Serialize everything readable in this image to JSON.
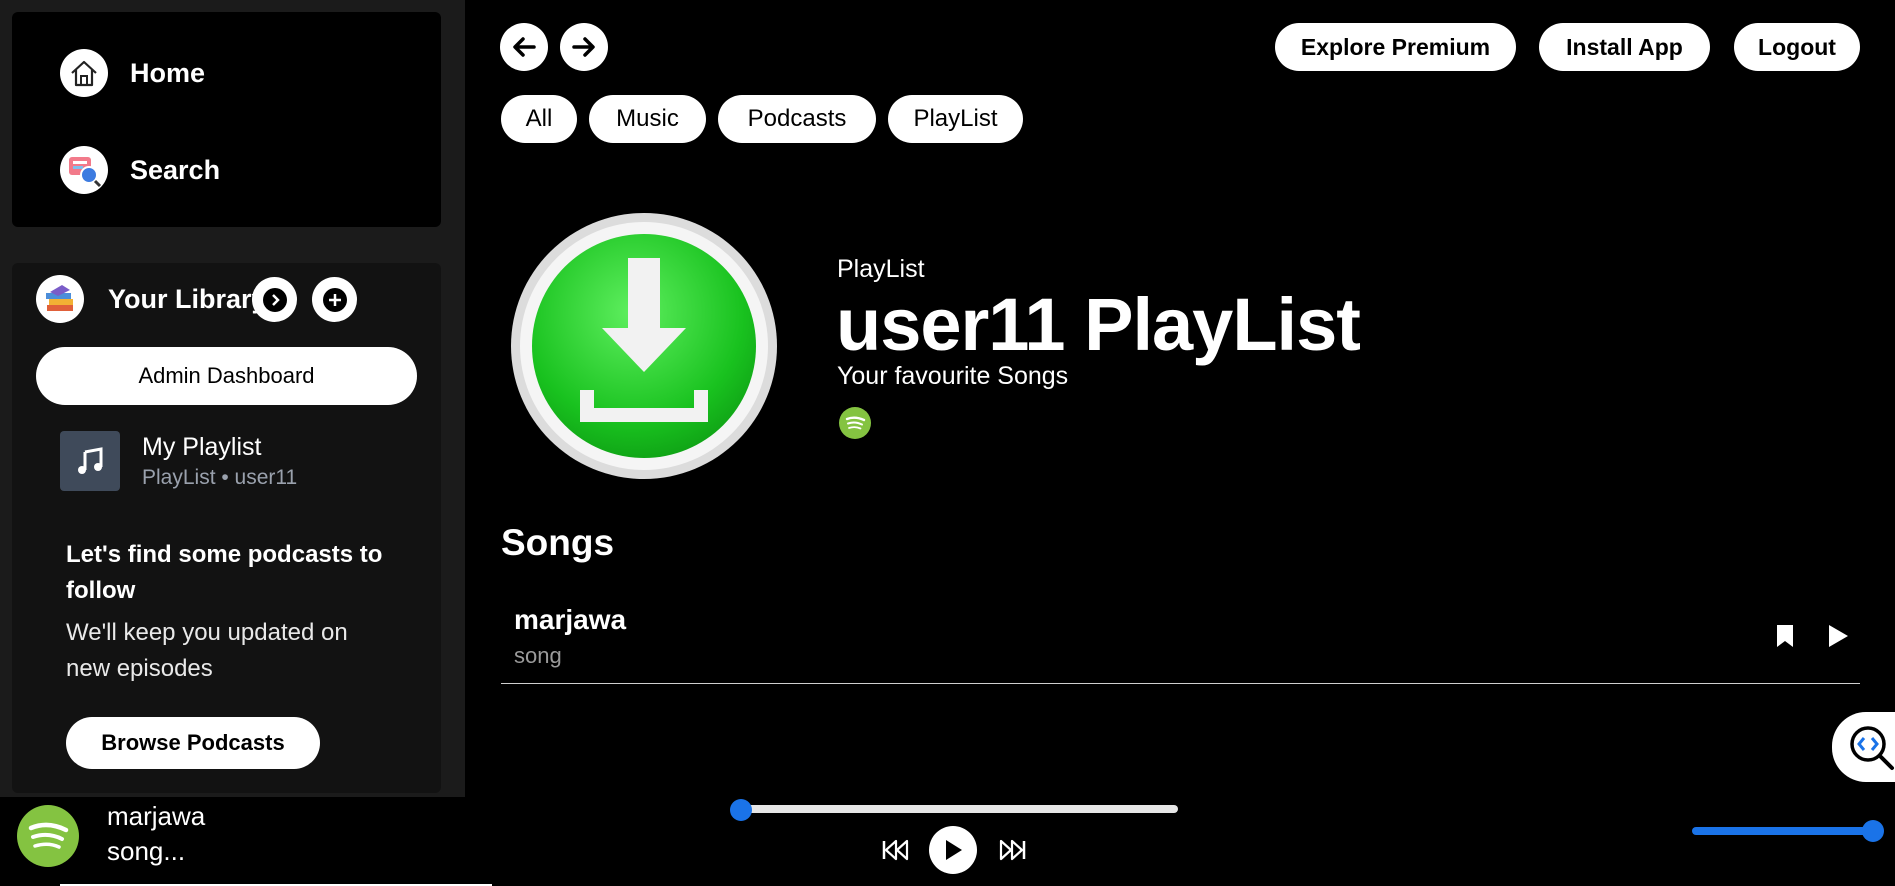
{
  "sidebar": {
    "nav": [
      {
        "label": "Home",
        "icon": "home-icon"
      },
      {
        "label": "Search",
        "icon": "search-icon"
      }
    ],
    "library": {
      "title": "Your Library",
      "admin_label": "Admin Dashboard",
      "playlist_name": "My Playlist",
      "playlist_meta": "PlayList • user11",
      "podcast_heading": "Let's find some podcasts to follow",
      "podcast_text": "We'll keep you updated on new episodes",
      "browse_label": "Browse Podcasts"
    }
  },
  "topbar": {
    "explore_label": "Explore Premium",
    "install_label": "Install App",
    "logout_label": "Logout"
  },
  "filters": [
    "All",
    "Music",
    "Podcasts",
    "PlayList"
  ],
  "playlist": {
    "type": "PlayList",
    "title": "user11 PlayList",
    "description": "Your favourite Songs"
  },
  "songs": {
    "heading": "Songs",
    "items": [
      {
        "name": "marjawa",
        "type": "song"
      }
    ]
  },
  "player": {
    "title": "marjawa",
    "subtitle": "song...",
    "progress": 0,
    "volume": 1.0
  },
  "colors": {
    "accent_blue": "#1a73e8",
    "spotify_green": "#84c341",
    "cover_green": "#2ecc40"
  }
}
